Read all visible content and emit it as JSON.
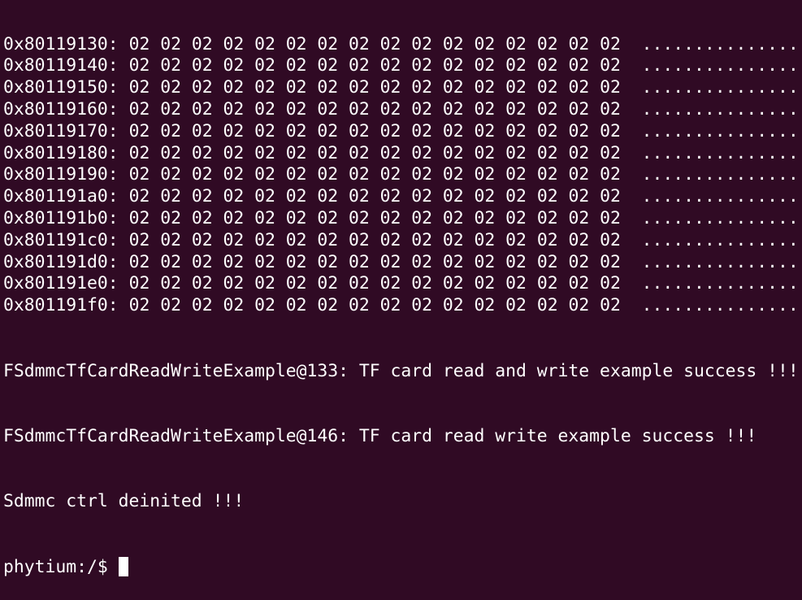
{
  "terminal": {
    "dump_rows": [
      {
        "address": "0x80119130:",
        "bytes": "02 02 02 02 02 02 02 02 02 02 02 02 02 02 02 02",
        "ascii": "................"
      },
      {
        "address": "0x80119140:",
        "bytes": "02 02 02 02 02 02 02 02 02 02 02 02 02 02 02 02",
        "ascii": "................"
      },
      {
        "address": "0x80119150:",
        "bytes": "02 02 02 02 02 02 02 02 02 02 02 02 02 02 02 02",
        "ascii": "................"
      },
      {
        "address": "0x80119160:",
        "bytes": "02 02 02 02 02 02 02 02 02 02 02 02 02 02 02 02",
        "ascii": "................"
      },
      {
        "address": "0x80119170:",
        "bytes": "02 02 02 02 02 02 02 02 02 02 02 02 02 02 02 02",
        "ascii": "................"
      },
      {
        "address": "0x80119180:",
        "bytes": "02 02 02 02 02 02 02 02 02 02 02 02 02 02 02 02",
        "ascii": "................"
      },
      {
        "address": "0x80119190:",
        "bytes": "02 02 02 02 02 02 02 02 02 02 02 02 02 02 02 02",
        "ascii": "................"
      },
      {
        "address": "0x801191a0:",
        "bytes": "02 02 02 02 02 02 02 02 02 02 02 02 02 02 02 02",
        "ascii": "................"
      },
      {
        "address": "0x801191b0:",
        "bytes": "02 02 02 02 02 02 02 02 02 02 02 02 02 02 02 02",
        "ascii": "................"
      },
      {
        "address": "0x801191c0:",
        "bytes": "02 02 02 02 02 02 02 02 02 02 02 02 02 02 02 02",
        "ascii": "................"
      },
      {
        "address": "0x801191d0:",
        "bytes": "02 02 02 02 02 02 02 02 02 02 02 02 02 02 02 02",
        "ascii": "................"
      },
      {
        "address": "0x801191e0:",
        "bytes": "02 02 02 02 02 02 02 02 02 02 02 02 02 02 02 02",
        "ascii": "................"
      },
      {
        "address": "0x801191f0:",
        "bytes": "02 02 02 02 02 02 02 02 02 02 02 02 02 02 02 02",
        "ascii": "................"
      }
    ],
    "messages": [
      "FSdmmcTfCardReadWriteExample@133: TF card read and write example success !!!",
      "FSdmmcTfCardReadWriteExample@146: TF card read write example success !!!",
      "Sdmmc ctrl deinited !!!"
    ],
    "prompt": "phytium:/$",
    "colors": {
      "background": "#300a24",
      "foreground": "#ffffff"
    }
  }
}
